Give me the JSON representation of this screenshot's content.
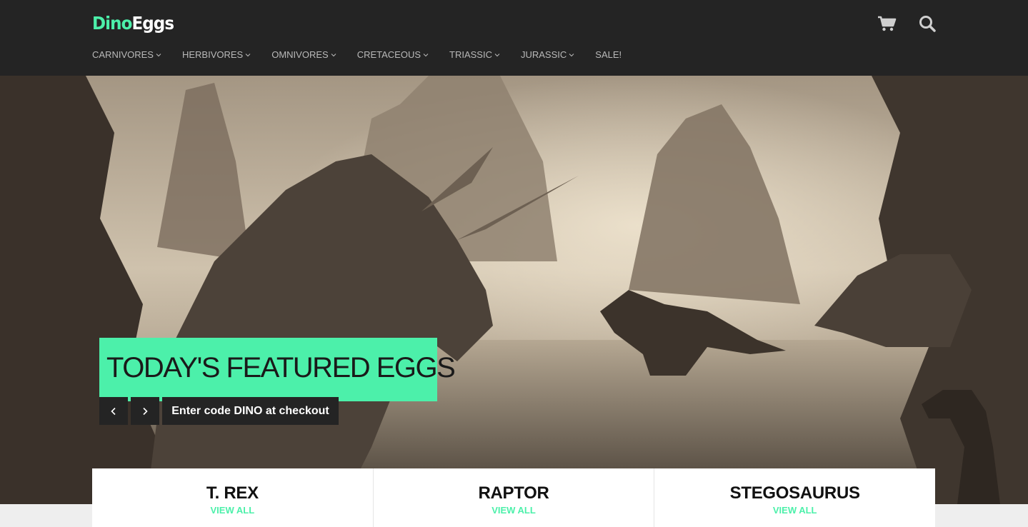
{
  "brand": {
    "part1": "Dino",
    "part2": "Eggs"
  },
  "header": {
    "icons": [
      "cart-icon",
      "search-icon"
    ],
    "nav": [
      {
        "label": "CARNIVORES",
        "has_dropdown": true
      },
      {
        "label": "HERBIVORES",
        "has_dropdown": true
      },
      {
        "label": "OMNIVORES",
        "has_dropdown": true
      },
      {
        "label": "CRETACEOUS",
        "has_dropdown": true
      },
      {
        "label": "TRIASSIC",
        "has_dropdown": true
      },
      {
        "label": "JURASSIC",
        "has_dropdown": true
      },
      {
        "label": "SALE!",
        "has_dropdown": false
      }
    ]
  },
  "hero": {
    "caption": "TODAY'S FEATURED EGGS",
    "promo": "Enter code DINO at checkout",
    "prev_icon": "chevron-left-icon",
    "next_icon": "chevron-right-icon"
  },
  "categories": [
    {
      "title": "T. REX",
      "link": "VIEW ALL"
    },
    {
      "title": "RAPTOR",
      "link": "VIEW ALL"
    },
    {
      "title": "STEGOSAURUS",
      "link": "VIEW ALL"
    }
  ],
  "colors": {
    "accent": "#4cf0aa",
    "header_bg": "#242424",
    "nav_text": "#b9b9b9"
  }
}
